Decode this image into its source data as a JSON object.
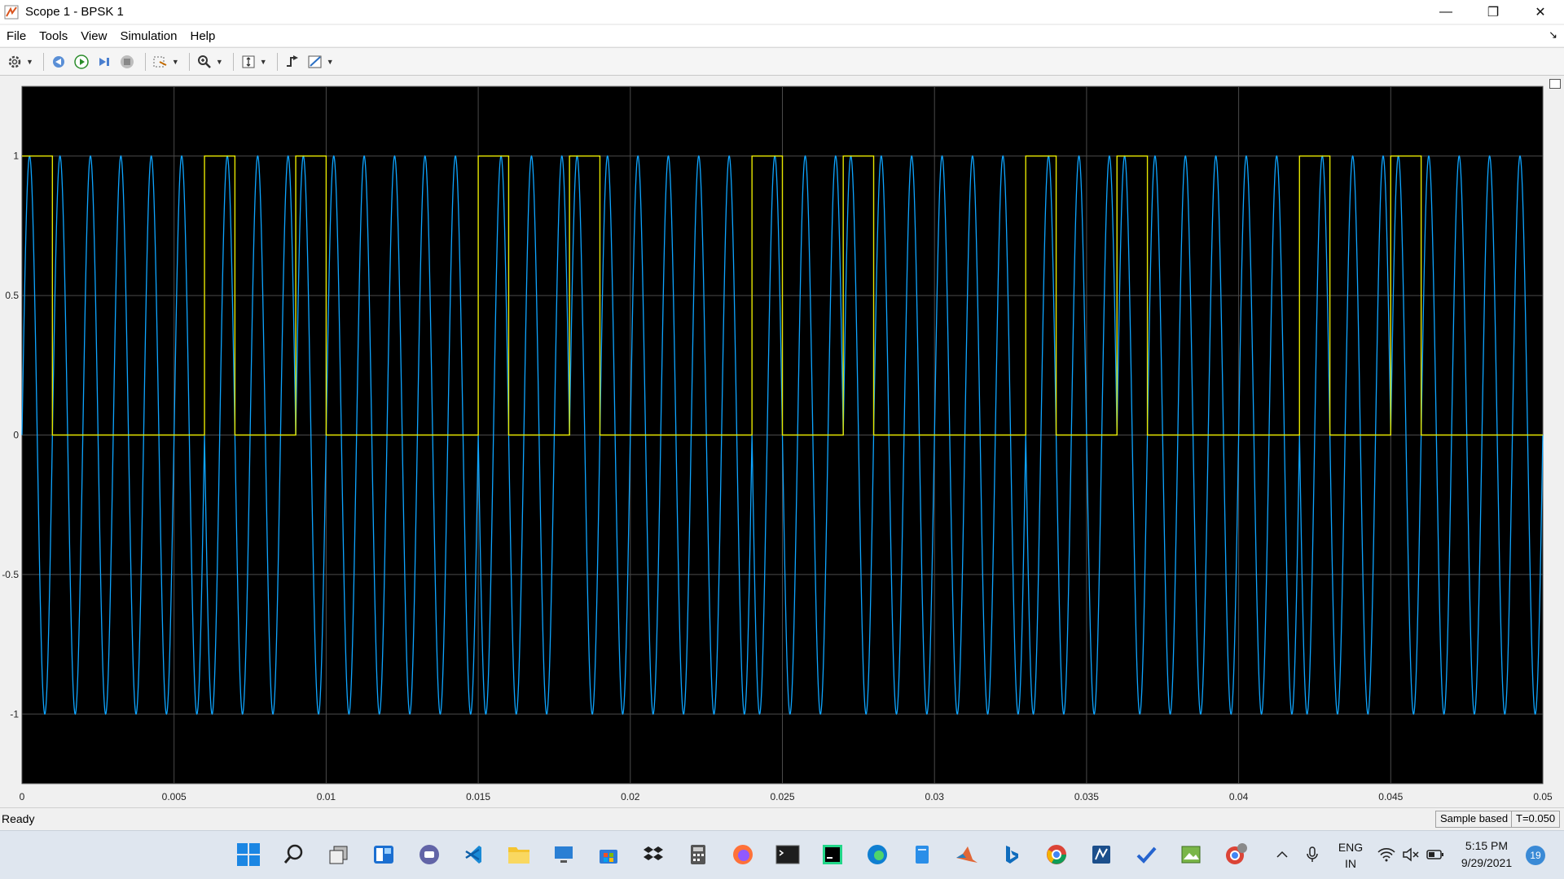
{
  "window": {
    "title": "Scope 1 - BPSK 1",
    "minimize": "—",
    "maximize": "❐",
    "close": "✕"
  },
  "menu": {
    "items": [
      "File",
      "Tools",
      "View",
      "Simulation",
      "Help"
    ],
    "collapse": "↘"
  },
  "toolbar": {
    "buttons": [
      "settings-gear-icon",
      "revert-icon",
      "run-icon",
      "step-forward-icon",
      "stop-icon",
      "highlight-icon",
      "zoom-in-icon",
      "scale-axes-icon",
      "triggers-icon",
      "measurements-icon"
    ]
  },
  "chart_data": {
    "type": "line",
    "title": "",
    "xlabel": "",
    "ylabel": "",
    "xlim": [
      0,
      0.05
    ],
    "ylim": [
      -1.25,
      1.25
    ],
    "grid": true,
    "background": "#000000",
    "x_ticks": [
      "0",
      "0.005",
      "0.01",
      "0.015",
      "0.02",
      "0.025",
      "0.03",
      "0.035",
      "0.04",
      "0.045",
      "0.05"
    ],
    "y_ticks": [
      "1",
      "0.5",
      "0",
      "-0.5",
      "-1"
    ],
    "series": [
      {
        "color": "#0ea5ff",
        "kind": "sine carrier",
        "frequency_hz": 1000,
        "amplitude": 1,
        "phase_flips_at": [
          0.006,
          0.009,
          0.015,
          0.018,
          0.024,
          0.027,
          0.033,
          0.036,
          0.042,
          0.045
        ]
      },
      {
        "color": "#e6e600",
        "kind": "square data",
        "pulses": [
          [
            0,
            0.001
          ],
          [
            0.006,
            0.007
          ],
          [
            0.009,
            0.01
          ],
          [
            0.015,
            0.016
          ],
          [
            0.018,
            0.019
          ],
          [
            0.024,
            0.025
          ],
          [
            0.027,
            0.028
          ],
          [
            0.033,
            0.034
          ],
          [
            0.036,
            0.037
          ],
          [
            0.042,
            0.043
          ],
          [
            0.045,
            0.046
          ]
        ]
      }
    ]
  },
  "status": {
    "text": "Ready",
    "mode": "Sample based",
    "time": "T=0.050"
  },
  "taskbar": {
    "apps": [
      "windows-start-icon",
      "search-icon",
      "task-view-icon",
      "widgets-icon",
      "teams-chat-icon",
      "vscode-icon",
      "file-explorer-icon",
      "remote-desktop-icon",
      "microsoft-store-icon",
      "dropbox-icon",
      "calculator-icon",
      "firefox-icon",
      "terminal-icon",
      "pycharm-icon",
      "edge-icon",
      "notepad-icon",
      "matlab-icon",
      "bing-icon",
      "chrome-icon",
      "vpn-icon",
      "todo-icon",
      "photos-icon",
      "chrome-profile-icon"
    ],
    "language_top": "ENG",
    "language_bottom": "IN",
    "time": "5:15 PM",
    "date": "9/29/2021",
    "notifications": "19"
  }
}
